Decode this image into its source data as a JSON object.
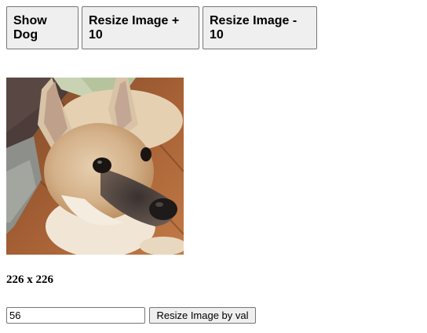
{
  "buttons": {
    "show_dog": "Show Dog",
    "resize_plus": "Resize Image + 10",
    "resize_minus": "Resize Image - 10",
    "resize_by_val": "Resize Image by val"
  },
  "image": {
    "subject": "puppy-photo"
  },
  "size_label": "226 x 226",
  "resize_input": {
    "value": "56"
  }
}
